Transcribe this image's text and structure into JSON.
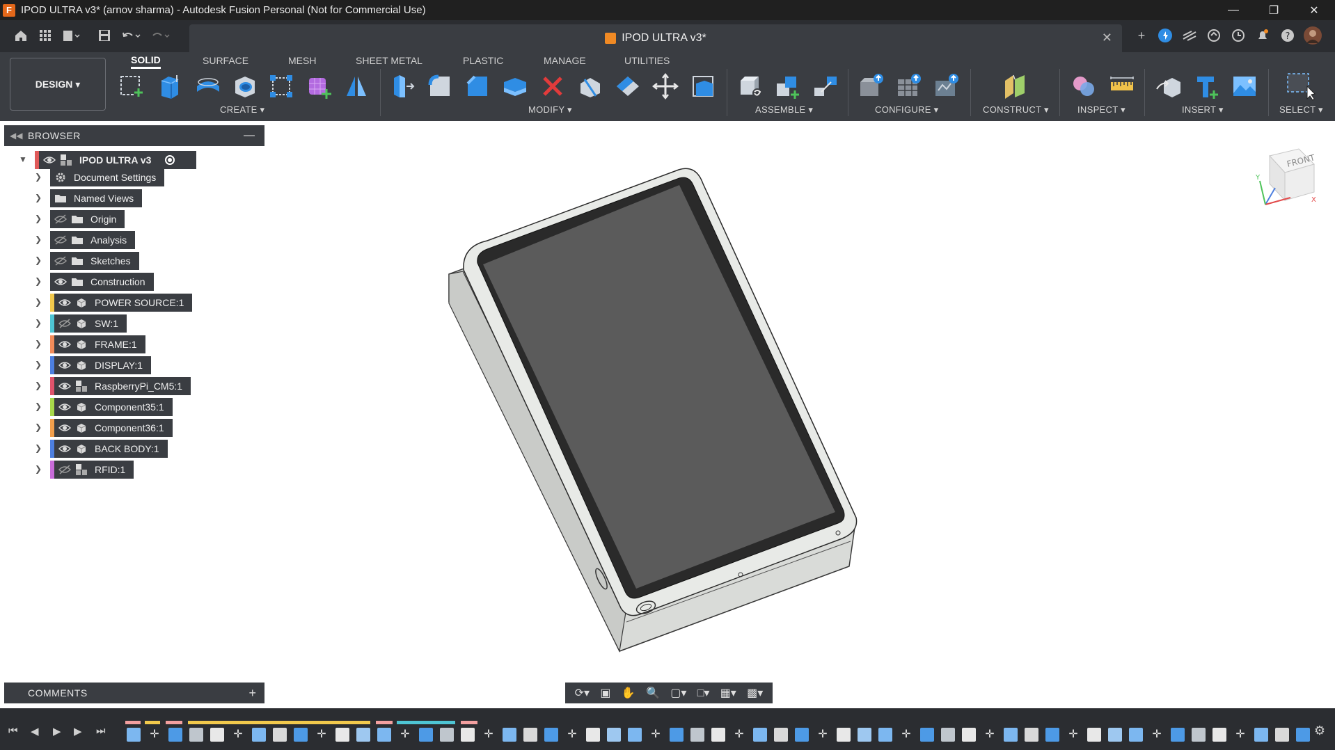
{
  "window": {
    "title": "IPOD ULTRA v3* (arnov sharma) - Autodesk Fusion Personal (Not for Commercial Use)",
    "logo_letter": "F"
  },
  "tab": {
    "title": "IPOD ULTRA v3*"
  },
  "workspace": {
    "label": "DESIGN ▾"
  },
  "ribbon_tabs": [
    "SOLID",
    "SURFACE",
    "MESH",
    "SHEET METAL",
    "PLASTIC",
    "MANAGE",
    "UTILITIES"
  ],
  "groups": {
    "create": "CREATE ▾",
    "modify": "MODIFY ▾",
    "assemble": "ASSEMBLE ▾",
    "configure": "CONFIGURE ▾",
    "construct": "CONSTRUCT ▾",
    "inspect": "INSPECT ▾",
    "insert": "INSERT ▾",
    "select": "SELECT ▾"
  },
  "browser": {
    "title": "BROWSER",
    "root": "IPOD ULTRA v3",
    "items": [
      {
        "label": "Document Settings",
        "icon": "gear-icon",
        "color": ""
      },
      {
        "label": "Named Views",
        "icon": "folder-icon",
        "color": ""
      },
      {
        "label": "Origin",
        "icon": "folder-icon",
        "color": ""
      },
      {
        "label": "Analysis",
        "icon": "folder-icon",
        "color": ""
      },
      {
        "label": "Sketches",
        "icon": "folder-icon",
        "color": ""
      },
      {
        "label": "Construction",
        "icon": "folder-icon",
        "color": ""
      },
      {
        "label": "POWER SOURCE:1",
        "icon": "component-icon",
        "color": "#f2c94c"
      },
      {
        "label": "SW:1",
        "icon": "component-icon",
        "color": "#4ec5d4"
      },
      {
        "label": "FRAME:1",
        "icon": "component-icon",
        "color": "#f28c5a"
      },
      {
        "label": "DISPLAY:1",
        "icon": "component-icon",
        "color": "#4d7fe0"
      },
      {
        "label": "RaspberryPi_CM5:1",
        "icon": "assembly-icon",
        "color": "#e0536b"
      },
      {
        "label": "Component35:1",
        "icon": "component-icon",
        "color": "#a8d94a"
      },
      {
        "label": "Component36:1",
        "icon": "component-icon",
        "color": "#f29f4c"
      },
      {
        "label": "BACK BODY:1",
        "icon": "component-icon",
        "color": "#4d7fe0"
      },
      {
        "label": "RFID:1",
        "icon": "assembly-icon",
        "color": "#c86bd9"
      }
    ]
  },
  "comments": {
    "title": "COMMENTS",
    "add": "+"
  },
  "viewcube": {
    "face": "FRONT"
  },
  "colors": {
    "accent": "#f08a24",
    "panel": "#3a3d42",
    "titlebar": "#202020"
  }
}
